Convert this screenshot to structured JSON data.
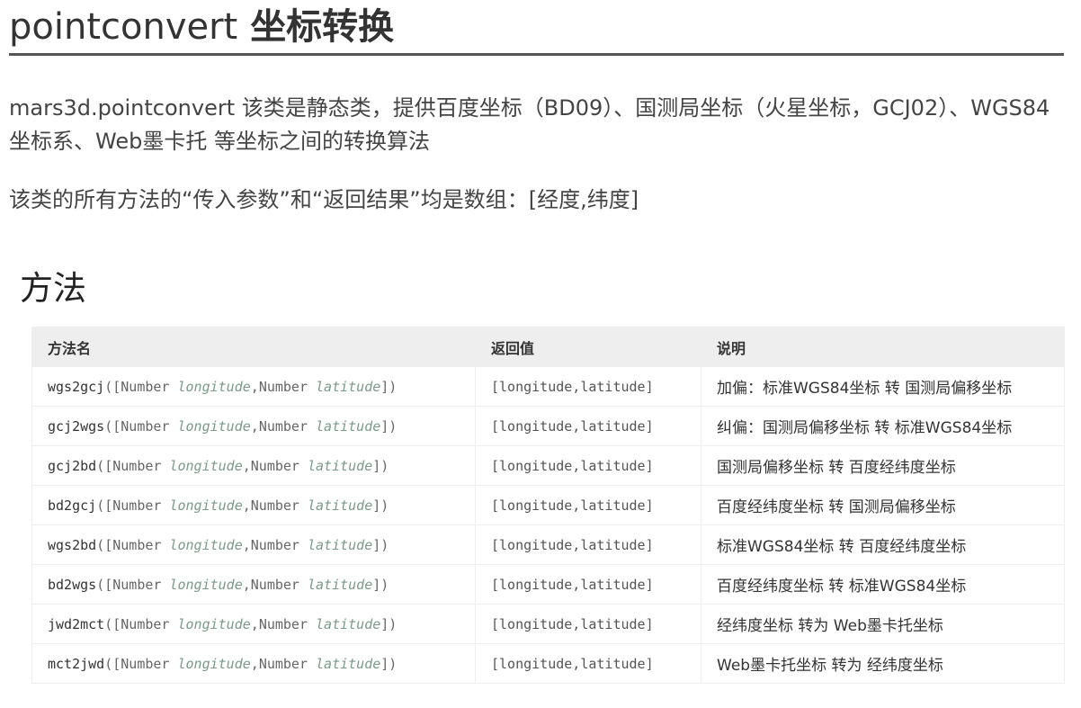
{
  "header": {
    "title_code": "pointconvert",
    "title_text": "坐标转换"
  },
  "intro": {
    "paragraph1": "mars3d.pointconvert 该类是静态类，提供百度坐标（BD09）、国测局坐标（火星坐标，GCJ02）、WGS84坐标系、Web墨卡托 等坐标之间的转换算法",
    "paragraph2": "该类的所有方法的“传入参数”和“返回结果”均是数组：[经度,纬度]"
  },
  "section": {
    "title": "方法"
  },
  "table": {
    "headers": {
      "name": "方法名",
      "returns": "返回值",
      "desc": "说明"
    },
    "param_type": "Number",
    "param1": "longitude",
    "param2": "latitude",
    "rows": [
      {
        "method": "wgs2gcj",
        "returns": "[longitude,latitude]",
        "desc": "加偏：标准WGS84坐标 转 国测局偏移坐标"
      },
      {
        "method": "gcj2wgs",
        "returns": "[longitude,latitude]",
        "desc": "纠偏：国测局偏移坐标 转 标准WGS84坐标"
      },
      {
        "method": "gcj2bd",
        "returns": "[longitude,latitude]",
        "desc": "国测局偏移坐标 转 百度经纬度坐标"
      },
      {
        "method": "bd2gcj",
        "returns": "[longitude,latitude]",
        "desc": "百度经纬度坐标 转 国测局偏移坐标"
      },
      {
        "method": "wgs2bd",
        "returns": "[longitude,latitude]",
        "desc": "标准WGS84坐标 转 百度经纬度坐标"
      },
      {
        "method": "bd2wgs",
        "returns": "[longitude,latitude]",
        "desc": "百度经纬度坐标 转 标准WGS84坐标"
      },
      {
        "method": "jwd2mct",
        "returns": "[longitude,latitude]",
        "desc": "经纬度坐标 转为 Web墨卡托坐标"
      },
      {
        "method": "mct2jwd",
        "returns": "[longitude,latitude]",
        "desc": "Web墨卡托坐标 转为 经纬度坐标"
      }
    ]
  }
}
